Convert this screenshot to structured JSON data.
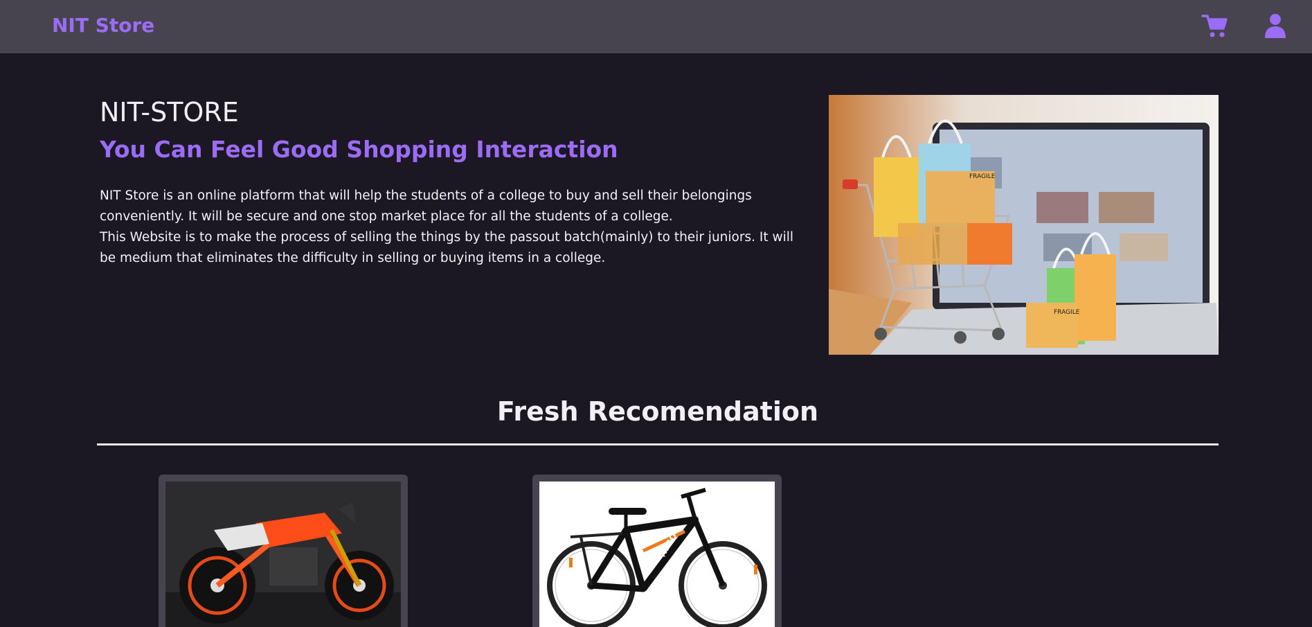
{
  "navbar": {
    "brand": "NIT Store",
    "cart_icon": "shopping-cart-icon",
    "user_icon": "user-icon",
    "accent_color": "#9b6cf5"
  },
  "hero": {
    "title": "NIT-STORE",
    "subtitle": "You Can Feel Good Shopping Interaction",
    "paragraph_1": "NIT Store is an online platform that will help the students of a college to buy and sell their belongings conveniently. It will be secure and one stop market place for all the students of a college.",
    "paragraph_2": "This Website is to make the process of selling the things by the passout batch(mainly) to their juniors. It will be medium that eliminates the difficulty in selling or buying items in a college.",
    "image_box_labels": [
      "FRAGILE",
      "FRAGILE"
    ]
  },
  "recommendations": {
    "title": "Fresh Recomendation",
    "products": [
      {
        "icon": "motorcycle-image"
      },
      {
        "icon": "bicycle-image",
        "brand_text": "HERO"
      }
    ]
  }
}
